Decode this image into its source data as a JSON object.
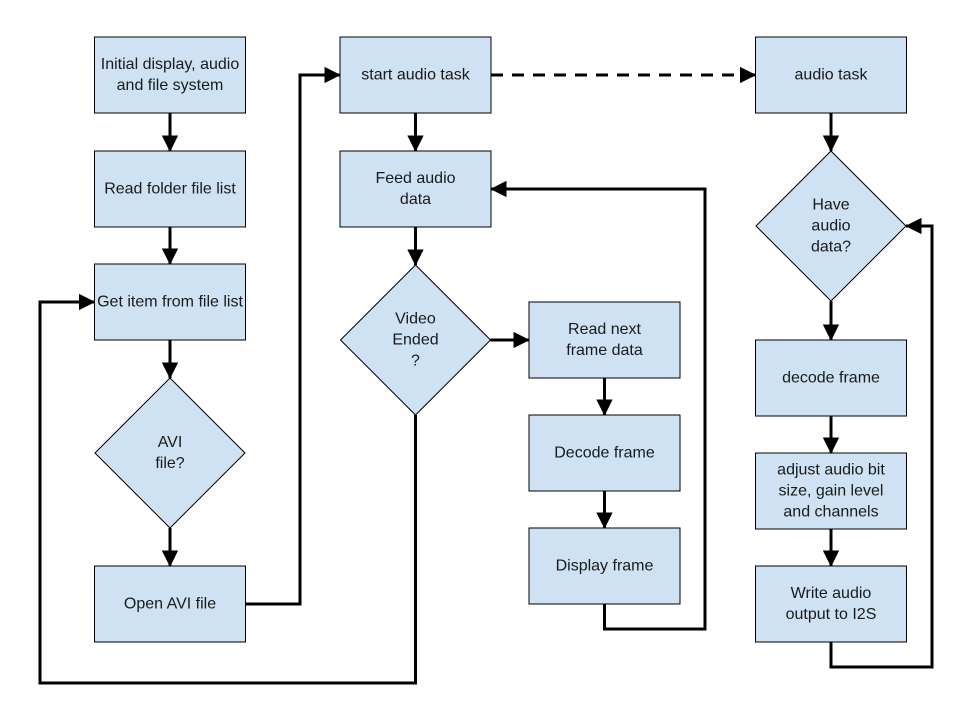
{
  "colors": {
    "node_fill": "#cfe2f3",
    "node_stroke": "#000000",
    "edge": "#000000",
    "text": "#1a1a1a"
  },
  "nodes": [
    {
      "id": "init",
      "shape": "rect",
      "lines": [
        "Initial display, audio",
        "and file system"
      ]
    },
    {
      "id": "read_folder",
      "shape": "rect",
      "lines": [
        "Read folder file list"
      ]
    },
    {
      "id": "get_item",
      "shape": "rect",
      "lines": [
        "Get item from file list"
      ]
    },
    {
      "id": "avi_check",
      "shape": "diamond",
      "lines": [
        "AVI",
        "file?"
      ]
    },
    {
      "id": "open_avi",
      "shape": "rect",
      "lines": [
        "Open AVI file"
      ]
    },
    {
      "id": "start_audio",
      "shape": "rect",
      "lines": [
        "start audio task"
      ]
    },
    {
      "id": "feed_audio",
      "shape": "rect",
      "lines": [
        "Feed audio",
        "data"
      ]
    },
    {
      "id": "video_ended",
      "shape": "diamond",
      "lines": [
        "Video",
        "Ended",
        "?"
      ]
    },
    {
      "id": "read_next",
      "shape": "rect",
      "lines": [
        "Read next",
        "frame data"
      ]
    },
    {
      "id": "decode_video",
      "shape": "rect",
      "lines": [
        "Decode frame"
      ]
    },
    {
      "id": "display_frame",
      "shape": "rect",
      "lines": [
        "Display frame"
      ]
    },
    {
      "id": "audio_task",
      "shape": "rect",
      "lines": [
        "audio task"
      ]
    },
    {
      "id": "have_audio",
      "shape": "diamond",
      "lines": [
        "Have",
        "audio",
        "data?"
      ]
    },
    {
      "id": "decode_audio",
      "shape": "rect",
      "lines": [
        "decode frame"
      ]
    },
    {
      "id": "adjust_audio",
      "shape": "rect",
      "lines": [
        "adjust audio bit",
        "size, gain level",
        "and channels"
      ]
    },
    {
      "id": "write_i2s",
      "shape": "rect",
      "lines": [
        "Write audio",
        "output to I2S"
      ]
    }
  ],
  "edges": [
    {
      "from": "init",
      "to": "read_folder",
      "style": "solid"
    },
    {
      "from": "read_folder",
      "to": "get_item",
      "style": "solid"
    },
    {
      "from": "get_item",
      "to": "avi_check",
      "style": "solid"
    },
    {
      "from": "avi_check",
      "to": "open_avi",
      "style": "solid"
    },
    {
      "from": "open_avi",
      "to": "start_audio",
      "style": "solid"
    },
    {
      "from": "start_audio",
      "to": "feed_audio",
      "style": "solid"
    },
    {
      "from": "start_audio",
      "to": "audio_task",
      "style": "dashed"
    },
    {
      "from": "feed_audio",
      "to": "video_ended",
      "style": "solid"
    },
    {
      "from": "video_ended",
      "to": "read_next",
      "style": "solid"
    },
    {
      "from": "video_ended",
      "to": "get_item",
      "style": "solid"
    },
    {
      "from": "read_next",
      "to": "decode_video",
      "style": "solid"
    },
    {
      "from": "decode_video",
      "to": "display_frame",
      "style": "solid"
    },
    {
      "from": "display_frame",
      "to": "feed_audio",
      "style": "solid"
    },
    {
      "from": "audio_task",
      "to": "have_audio",
      "style": "solid"
    },
    {
      "from": "have_audio",
      "to": "decode_audio",
      "style": "solid"
    },
    {
      "from": "decode_audio",
      "to": "adjust_audio",
      "style": "solid"
    },
    {
      "from": "adjust_audio",
      "to": "write_i2s",
      "style": "solid"
    },
    {
      "from": "write_i2s",
      "to": "have_audio",
      "style": "solid"
    }
  ]
}
